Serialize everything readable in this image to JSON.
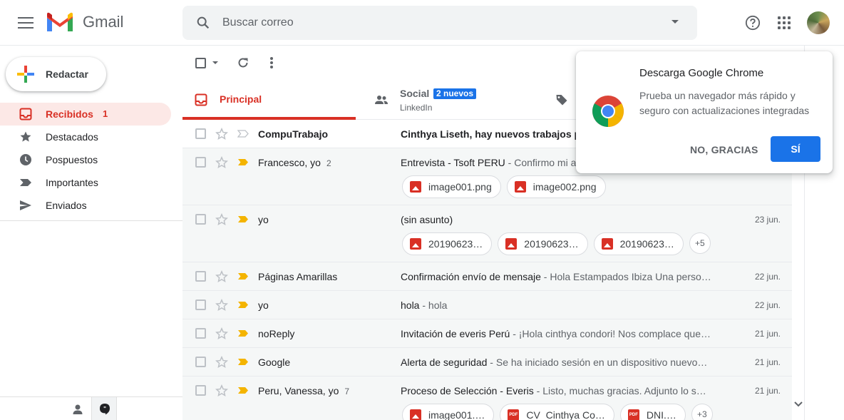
{
  "header": {
    "app_name": "Gmail",
    "search_placeholder": "Buscar correo"
  },
  "sidebar": {
    "compose_label": "Redactar",
    "items": [
      {
        "label": "Recibidos",
        "count": "1",
        "icon": "inbox-icon",
        "active": true
      },
      {
        "label": "Destacados",
        "icon": "star-icon"
      },
      {
        "label": "Pospuestos",
        "icon": "clock-icon"
      },
      {
        "label": "Importantes",
        "icon": "label-important-icon"
      },
      {
        "label": "Enviados",
        "icon": "send-icon"
      }
    ]
  },
  "tabs": {
    "primary": "Principal",
    "social": "Social",
    "social_badge": "2 nuevos",
    "social_sub": "LinkedIn"
  },
  "emails": [
    {
      "sender": "CompuTrabajo",
      "count": "",
      "subject": "Cinthya Liseth, hay nuevos trabajos pa",
      "snippet": "",
      "date": "",
      "unread": true
    },
    {
      "sender": "Francesco, yo",
      "count": "2",
      "subject": "Entrevista - Tsoft PERU",
      "snippet": " - Confirmo mi a",
      "date": "",
      "attachments": [
        "image001.png",
        "image002.png"
      ]
    },
    {
      "sender": "yo",
      "count": "",
      "subject": "(sin asunto)",
      "snippet": "",
      "date": "23 jun.",
      "attachments": [
        "20190623…",
        "20190623…",
        "20190623…"
      ],
      "more": "+5"
    },
    {
      "sender": "Páginas Amarillas",
      "count": "",
      "subject": "Confirmación envío de mensaje",
      "snippet": " - Hola Estampados Ibiza Una perso…",
      "date": "22 jun."
    },
    {
      "sender": "yo",
      "count": "",
      "subject": "hola",
      "snippet": " - hola",
      "date": "22 jun."
    },
    {
      "sender": "noReply",
      "count": "",
      "subject": "Invitación de everis Perú",
      "snippet": " - ¡Hola cinthya condori! Nos complace que…",
      "date": "21 jun."
    },
    {
      "sender": "Google",
      "count": "",
      "subject": "Alerta de seguridad",
      "snippet": " - Se ha iniciado sesión en un dispositivo nuevo…",
      "date": "21 jun."
    },
    {
      "sender": "Peru, Vanessa, yo",
      "count": "7",
      "subject": "Proceso de Selección - Everis",
      "snippet": " - Listo, muchas gracias. Adjunto lo s…",
      "date": "21 jun.",
      "attachments": [
        "image001.…",
        "CV_Cinthya Co…",
        "DNI.…"
      ],
      "more": "+3"
    }
  ],
  "popup": {
    "title": "Descarga Google Chrome",
    "body": "Prueba un navegador más rápido y seguro con actualizaciones integradas",
    "no_label": "NO, GRACIAS",
    "yes_label": "SÍ"
  },
  "colors": {
    "accent_red": "#d93025",
    "accent_blue": "#1a73e8"
  }
}
